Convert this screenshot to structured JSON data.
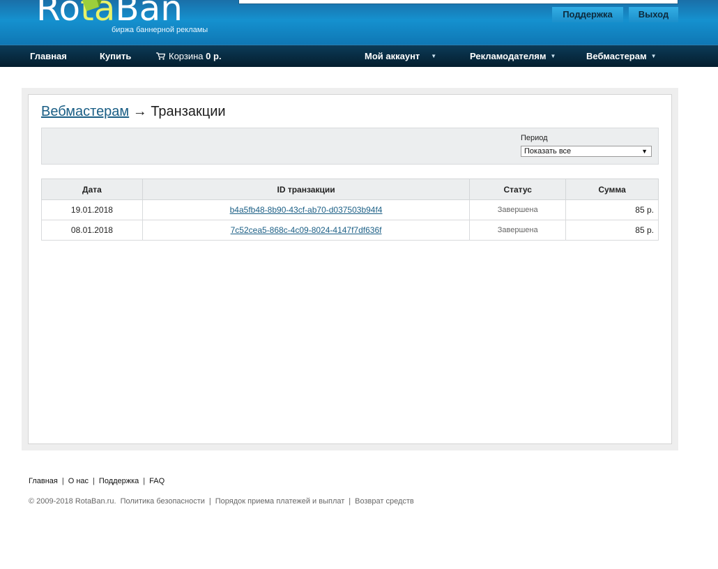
{
  "header": {
    "logo_text_1": "Ro",
    "logo_text_2": "ta",
    "logo_text_3": "Ban",
    "tagline": "биржа баннерной рекламы",
    "support_label": "Поддержка",
    "exit_label": "Выход"
  },
  "nav": {
    "home": "Главная",
    "buy": "Купить",
    "cart_label": "Корзина",
    "cart_sum": "0 р.",
    "account": "Мой аккаунт",
    "advertisers": "Рекламодателям",
    "webmasters": "Вебмастерам"
  },
  "breadcrumb": {
    "parent": "Вебмастерам",
    "arrow": "→",
    "current": "Транзакции"
  },
  "filter": {
    "label": "Период",
    "selected": "Показать все"
  },
  "table": {
    "headers": [
      "Дата",
      "ID транзакции",
      "Статус",
      "Сумма"
    ],
    "rows": [
      {
        "date": "19.01.2018",
        "id": "b4a5fb48-8b90-43cf-ab70-d037503b94f4",
        "status": "Завершена",
        "sum": "85 р."
      },
      {
        "date": "08.01.2018",
        "id": "7c52cea5-868c-4c09-8024-4147f7df636f",
        "status": "Завершена",
        "sum": "85 р."
      }
    ]
  },
  "footer": {
    "links": [
      "Главная",
      "О нас",
      "Поддержка",
      "FAQ"
    ],
    "copyright": "© 2009-2018 RotaBan.ru.",
    "policy": "Политика безопасности",
    "payments": "Порядок приема платежей и выплат",
    "refund": "Возврат средств"
  },
  "colors": {
    "header_blue": "#1591cf",
    "nav_dark": "#041e2e",
    "link_blue": "#1a5e85"
  }
}
